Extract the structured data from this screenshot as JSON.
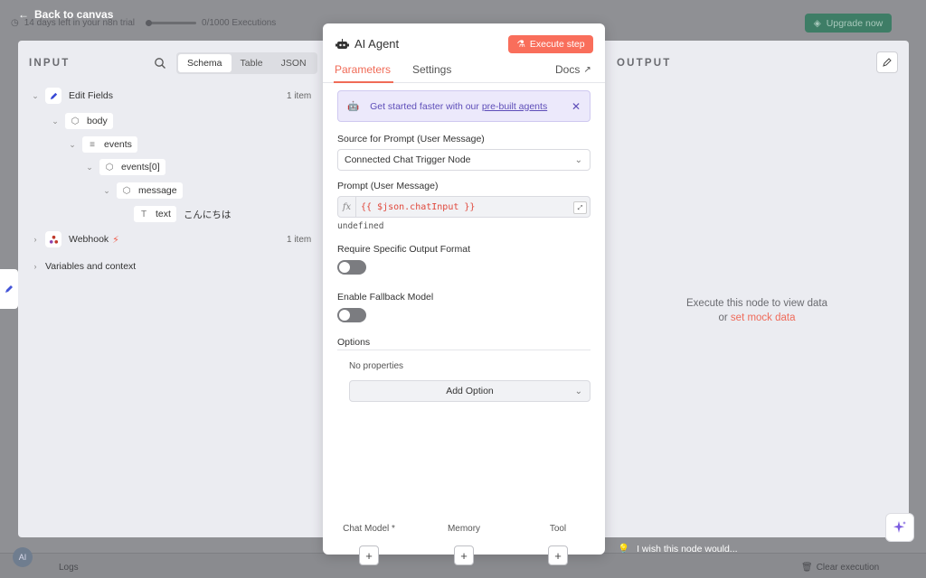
{
  "topbar": {
    "trial_text": "14 days left in your n8n trial",
    "executions": "0/1000 Executions",
    "upgrade_label": "Upgrade now",
    "back_label": "Back to canvas"
  },
  "bottombar": {
    "logs_label": "Logs",
    "clear_label": "Clear execution",
    "avatar_initials": "AI"
  },
  "input": {
    "title": "INPUT",
    "view_tabs": [
      "Schema",
      "Table",
      "JSON"
    ],
    "active_view": "Schema",
    "tree": {
      "edit_fields": {
        "label": "Edit Fields",
        "count": "1 item"
      },
      "body": "body",
      "events": "events",
      "events0": "events[0]",
      "message": "message",
      "text_key": "text",
      "text_value": "こんにちは",
      "webhook": {
        "label": "Webhook",
        "count": "1 item"
      },
      "variables": "Variables and context"
    }
  },
  "output": {
    "title": "OUTPUT",
    "msg_line1": "Execute this node to view data",
    "msg_or": "or",
    "msg_link": "set mock data",
    "wish": "I wish this node would..."
  },
  "modal": {
    "title": "AI Agent",
    "execute_label": "Execute step",
    "tabs": {
      "parameters": "Parameters",
      "settings": "Settings",
      "docs": "Docs"
    },
    "banner": {
      "text": "Get started faster with our",
      "link": "pre-built agents"
    },
    "source_label": "Source for Prompt (User Message)",
    "source_value": "Connected Chat Trigger Node",
    "prompt_label": "Prompt (User Message)",
    "prompt_expr": "{{ $json.chatInput }}",
    "prompt_result": "undefined",
    "require_label": "Require Specific Output Format",
    "fallback_label": "Enable Fallback Model",
    "options_label": "Options",
    "no_props": "No properties",
    "add_option": "Add Option",
    "subnodes": {
      "chat_model": "Chat Model *",
      "memory": "Memory",
      "tool": "Tool"
    }
  },
  "colors": {
    "accent": "#f06b57",
    "banner_bg": "#ece9fb",
    "banner_text": "#5d4db8"
  }
}
